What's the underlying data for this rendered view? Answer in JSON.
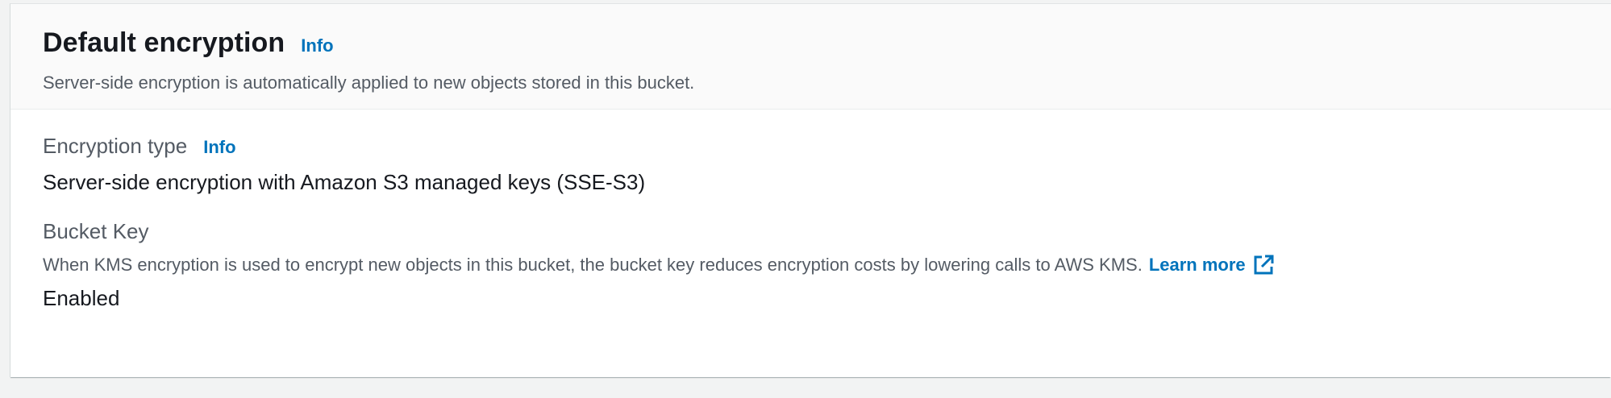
{
  "header": {
    "title": "Default encryption",
    "info_label": "Info",
    "description": "Server-side encryption is automatically applied to new objects stored in this bucket."
  },
  "encryption_type": {
    "label": "Encryption type",
    "info_label": "Info",
    "value": "Server-side encryption with Amazon S3 managed keys (SSE-S3)"
  },
  "bucket_key": {
    "label": "Bucket Key",
    "description": "When KMS encryption is used to encrypt new objects in this bucket, the bucket key reduces encryption costs by lowering calls to AWS KMS.",
    "learn_more_label": "Learn more",
    "learn_more_icon": "external-link-icon",
    "value": "Enabled"
  },
  "colors": {
    "link": "#0073bb",
    "text_primary": "#16191f",
    "text_secondary": "#545b64",
    "background": "#f2f3f3"
  }
}
